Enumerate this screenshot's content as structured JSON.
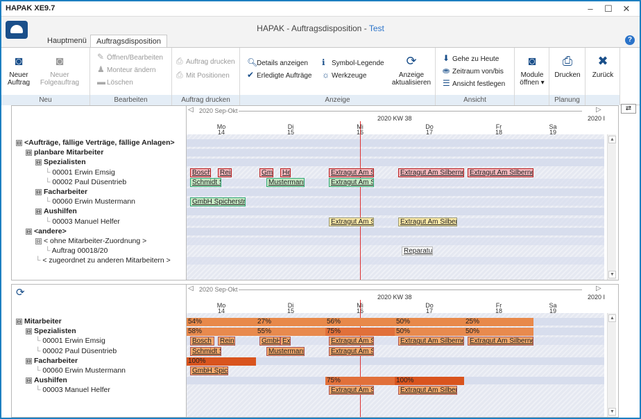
{
  "app_title": "HAPAK XE9.7",
  "window_controls": [
    "–",
    "☐",
    "✕"
  ],
  "header": {
    "title_main": "HAPAK - Auftragsdisposition - ",
    "title_env": "Test",
    "tabs": [
      "Hauptmenü",
      "Auftragsdisposition"
    ],
    "help": "?"
  },
  "ribbon": {
    "groups": [
      "Neu",
      "Bearbeiten",
      "Auftrag drucken",
      "Anzeige",
      "Ansicht",
      "",
      "Planung",
      ""
    ],
    "neu": {
      "neuer_auftrag": "Neuer\nAuftrag",
      "neuer_folgeauftrag": "Neuer\nFolgeauftrag"
    },
    "bearbeiten": {
      "oeffnen": "Öffnen/Bearbeiten",
      "monteur": "Monteur ändern",
      "loeschen": "Löschen"
    },
    "drucken": {
      "auftrag_drucken": "Auftrag drucken",
      "mit_positionen": "Mit Positionen"
    },
    "anzeige": {
      "details": "Details anzeigen",
      "erledigte": "Erledigte Aufträge",
      "symbol": "Symbol-Legende",
      "werkzeuge": "Werkzeuge",
      "aktualisieren": "Anzeige\naktualisieren"
    },
    "ansicht": {
      "heute": "Gehe zu Heute",
      "zeitraum": "Zeitraum von/bis",
      "festlegen": "Ansicht festlegen"
    },
    "module": "Module\nöffnen ▾",
    "drucken_btn": "Drucken",
    "zurueck": "Zurück"
  },
  "timeline": {
    "range_label": "2020 Sep-Okt",
    "kw": "2020 KW 38",
    "kw_right": "2020 I",
    "days": [
      {
        "d": "Mo",
        "n": "14"
      },
      {
        "d": "Di",
        "n": "15"
      },
      {
        "d": "Mi",
        "n": "16"
      },
      {
        "d": "Do",
        "n": "17"
      },
      {
        "d": "Fr",
        "n": "18"
      },
      {
        "d": "Sa",
        "n": "19"
      }
    ]
  },
  "top_tree": [
    {
      "t": "<Aufträge, fällige Verträge, fällige Anlagen>",
      "b": true,
      "lvl": 0,
      "g": "⊟"
    },
    {
      "t": "planbare Mitarbeiter",
      "b": true,
      "lvl": 1,
      "g": "⊟"
    },
    {
      "t": "Spezialisten",
      "b": true,
      "lvl": 2,
      "g": "⊟"
    },
    {
      "t": "00001 Erwin Emsig",
      "b": false,
      "lvl": 3
    },
    {
      "t": "00002 Paul Düsentrieb",
      "b": false,
      "lvl": 3
    },
    {
      "t": "Facharbeiter",
      "b": true,
      "lvl": 2,
      "g": "⊟"
    },
    {
      "t": "00060 Erwin Mustermann",
      "b": false,
      "lvl": 3
    },
    {
      "t": "Aushilfen",
      "b": true,
      "lvl": 2,
      "g": "⊟"
    },
    {
      "t": "00003 Manuel Helfer",
      "b": false,
      "lvl": 3
    },
    {
      "t": "<andere>",
      "b": true,
      "lvl": 1,
      "g": "⊟"
    },
    {
      "t": "< ohne Mitarbeiter-Zuordnung >",
      "b": false,
      "lvl": 2,
      "g": "⊟"
    },
    {
      "t": "Auftrag 00018/20",
      "b": false,
      "lvl": 3
    },
    {
      "t": "< zugeordnet zu anderen Mitarbeitern >",
      "b": false,
      "lvl": 2
    }
  ],
  "top_bars": [
    {
      "row": 3,
      "s": 0.05,
      "e": 0.35,
      "t": "Bosch",
      "c": "red"
    },
    {
      "row": 3,
      "s": 0.45,
      "e": 0.65,
      "t": "Rein",
      "c": "red"
    },
    {
      "row": 3,
      "s": 1.05,
      "e": 1.25,
      "t": "GmbH",
      "c": "red"
    },
    {
      "row": 3,
      "s": 1.35,
      "e": 1.5,
      "t": "He",
      "c": "red"
    },
    {
      "row": 3,
      "s": 2.05,
      "e": 2.7,
      "t": "Extragut Am S",
      "c": "red"
    },
    {
      "row": 3,
      "s": 3.05,
      "e": 4.0,
      "t": "Extragut Am Silberner",
      "c": "red"
    },
    {
      "row": 3,
      "s": 4.05,
      "e": 5.0,
      "t": "Extragut Am Silberner",
      "c": "red"
    },
    {
      "row": 4,
      "s": 0.05,
      "e": 0.5,
      "t": "Schmidt S",
      "c": "grn"
    },
    {
      "row": 4,
      "s": 1.15,
      "e": 1.7,
      "t": "Mustermann",
      "c": "grn"
    },
    {
      "row": 4,
      "s": 2.05,
      "e": 2.7,
      "t": "Extragut Am S",
      "c": "grn"
    },
    {
      "row": 6,
      "s": 0.05,
      "e": 0.85,
      "t": "GmbH Spicherstraße",
      "c": "grn"
    },
    {
      "row": 8,
      "s": 2.05,
      "e": 2.7,
      "t": "Extragut Am S",
      "c": "yel"
    },
    {
      "row": 8,
      "s": 3.05,
      "e": 3.9,
      "t": "Extragut Am Silben",
      "c": "yel"
    },
    {
      "row": 11,
      "s": 3.1,
      "e": 3.55,
      "t": "Reparatu",
      "c": "white"
    }
  ],
  "bottom_tree": [
    {
      "t": "Mitarbeiter",
      "b": true,
      "lvl": 0,
      "g": "⊟"
    },
    {
      "t": "Spezialisten",
      "b": true,
      "lvl": 1,
      "g": "⊟"
    },
    {
      "t": "00001 Erwin Emsig",
      "b": false,
      "lvl": 2
    },
    {
      "t": "00002 Paul Düsentrieb",
      "b": false,
      "lvl": 2
    },
    {
      "t": "Facharbeiter",
      "b": true,
      "lvl": 1,
      "g": "⊟"
    },
    {
      "t": "00060 Erwin Mustermann",
      "b": false,
      "lvl": 2
    },
    {
      "t": "Aushilfen",
      "b": true,
      "lvl": 1,
      "g": "⊟"
    },
    {
      "t": "00003 Manuel Helfer",
      "b": false,
      "lvl": 2
    }
  ],
  "bottom_loads": [
    {
      "row": 0,
      "s": 0,
      "e": 1,
      "t": "54%",
      "c": "#e8894a"
    },
    {
      "row": 0,
      "s": 1,
      "e": 2,
      "t": "27%",
      "c": "#e8894a"
    },
    {
      "row": 0,
      "s": 2,
      "e": 3,
      "t": "56%",
      "c": "#e8894a"
    },
    {
      "row": 0,
      "s": 3,
      "e": 4,
      "t": "50%",
      "c": "#e8894a"
    },
    {
      "row": 0,
      "s": 4,
      "e": 5,
      "t": "25%",
      "c": "#e8894a"
    },
    {
      "row": 1,
      "s": 0,
      "e": 1,
      "t": "58%",
      "c": "#e88a4e"
    },
    {
      "row": 1,
      "s": 1,
      "e": 2,
      "t": "55%",
      "c": "#e88a4e"
    },
    {
      "row": 1,
      "s": 2,
      "e": 3,
      "t": "75%",
      "c": "#e1703a"
    },
    {
      "row": 1,
      "s": 3,
      "e": 4,
      "t": "50%",
      "c": "#e88a4e"
    },
    {
      "row": 1,
      "s": 4,
      "e": 5,
      "t": "50%",
      "c": "#e88a4e"
    },
    {
      "row": 4,
      "s": 0,
      "e": 1,
      "t": "100%",
      "c": "#d9541e"
    },
    {
      "row": 6,
      "s": 2,
      "e": 3,
      "t": "75%",
      "c": "#e1703a"
    },
    {
      "row": 6,
      "s": 3,
      "e": 4,
      "t": "100%",
      "c": "#d9541e"
    }
  ],
  "bottom_bars": [
    {
      "row": 2,
      "s": 0.05,
      "e": 0.4,
      "t": "Bosch",
      "c": "org"
    },
    {
      "row": 2,
      "s": 0.45,
      "e": 0.7,
      "t": "Rein",
      "c": "org"
    },
    {
      "row": 2,
      "s": 1.05,
      "e": 1.35,
      "t": "GmbH",
      "c": "org"
    },
    {
      "row": 2,
      "s": 1.35,
      "e": 1.5,
      "t": "Ex",
      "c": "org"
    },
    {
      "row": 2,
      "s": 2.05,
      "e": 2.7,
      "t": "Extragut Am Sil",
      "c": "org"
    },
    {
      "row": 2,
      "s": 3.05,
      "e": 4.0,
      "t": "Extragut Am Silbernen",
      "c": "org"
    },
    {
      "row": 2,
      "s": 4.05,
      "e": 5.0,
      "t": "Extragut Am Silbernen",
      "c": "org"
    },
    {
      "row": 3,
      "s": 0.05,
      "e": 0.5,
      "t": "Schmidt S",
      "c": "org"
    },
    {
      "row": 3,
      "s": 1.15,
      "e": 1.7,
      "t": "Mustermann",
      "c": "org"
    },
    {
      "row": 3,
      "s": 2.05,
      "e": 2.7,
      "t": "Extragut Am Sil",
      "c": "org"
    },
    {
      "row": 5,
      "s": 0.05,
      "e": 0.6,
      "t": "GmbH Spicherstraße",
      "c": "org"
    },
    {
      "row": 7,
      "s": 2.05,
      "e": 2.7,
      "t": "Extragut Am Sil",
      "c": "org"
    },
    {
      "row": 7,
      "s": 3.05,
      "e": 3.9,
      "t": "Extragut Am Silberne",
      "c": "org"
    }
  ]
}
